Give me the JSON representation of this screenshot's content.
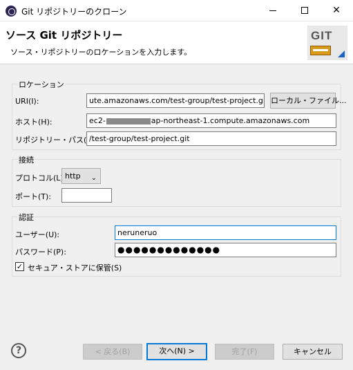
{
  "window": {
    "title": "Git リポジトリーのクローン",
    "minimize_glyph": "",
    "maximize_glyph": "",
    "close_glyph": "✕"
  },
  "banner": {
    "title": "ソース Git リポジトリー",
    "description": "ソース・リポジトリーのロケーションを入力します。",
    "logo_text": "GIT"
  },
  "location": {
    "group_label": "ロケーション",
    "uri_label": "URI(I):",
    "uri_value": "ute.amazonaws.com/test-group/test-project.git",
    "local_file_button": "ローカル・ファイル...",
    "host_label": "ホスト(H):",
    "host_value_prefix": "ec2-",
    "host_value_suffix": "ap-northeast-1.compute.amazonaws.com",
    "repo_path_label": "リポジトリー・パス(R):",
    "repo_path_value": "/test-group/test-project.git"
  },
  "connection": {
    "group_label": "接続",
    "protocol_label": "プロトコル(L):",
    "protocol_value": "http",
    "port_label": "ポート(T):",
    "port_value": ""
  },
  "auth": {
    "group_label": "認証",
    "user_label": "ユーザー(U):",
    "user_value": "neruneruo",
    "password_label": "パスワード(P):",
    "password_value": "●●●●●●●●●●●●●",
    "store_label": "セキュア・ストアに保管(S)",
    "store_checked": true
  },
  "footer": {
    "help_glyph": "?",
    "back_button": "< 戻る(B)",
    "next_button": "次へ(N) >",
    "finish_button": "完了(F)",
    "cancel_button": "キャンセル"
  },
  "colors": {
    "accent": "#0078d7",
    "dialog_bg": "#f0f0f0"
  }
}
